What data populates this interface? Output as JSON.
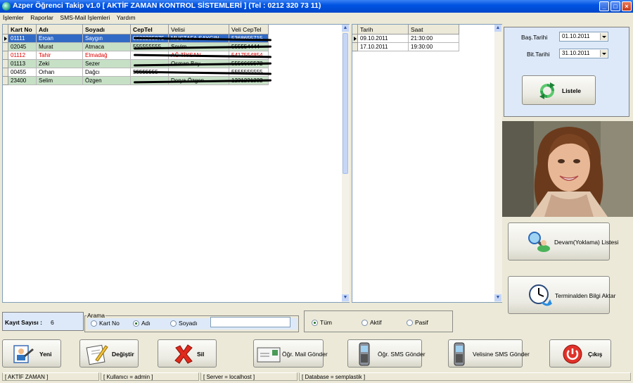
{
  "window": {
    "title": "Azper Öğrenci Takip v1.0 [ AKTİF ZAMAN KONTROL  SİSTEMLERİ  ] (Tel : 0212 320 73 11)",
    "controls": [
      "_",
      "□",
      "×"
    ]
  },
  "menu": [
    "İşlemler",
    "Raporlar",
    "SMS-Mail İşlemleri",
    "Yardım"
  ],
  "students": {
    "columns": [
      "Kart No",
      "Adı",
      "Soyadı",
      "CepTel",
      "Velisi",
      "Veli CepTel"
    ],
    "rows": [
      {
        "kart": "01111",
        "adi": "Ercan",
        "soyadi": "Saygın",
        "cep": "0538205875",
        "veli": "MUSTAFA SAYGIN",
        "velicep": "5368655715",
        "state": "selected"
      },
      {
        "kart": "02045",
        "adi": "Murat",
        "soyadi": "Atmaca",
        "cep": "555555555",
        "veli": "Sevim",
        "velicep": "555554444",
        "state": "normal"
      },
      {
        "kart": "01112",
        "adi": "Tahir",
        "soyadi": "Elmadağ",
        "cep": "",
        "veli": "AĞ TİYSAN",
        "velicep": "5417554854",
        "state": "red"
      },
      {
        "kart": "01113",
        "adi": "Zeki",
        "soyadi": "Sezer",
        "cep": "",
        "veli": "Osman Bey",
        "velicep": "5556665572",
        "state": "normal"
      },
      {
        "kart": "00455",
        "adi": "Orhan",
        "soyadi": "Dağcı",
        "cep": "55555555",
        "veli": "",
        "velicep": "5555555555",
        "state": "normal"
      },
      {
        "kart": "23400",
        "adi": "Selim",
        "soyadi": "Özgen",
        "cep": "",
        "veli": "Derya Özgen",
        "velicep": "1231231232",
        "state": "normal"
      }
    ]
  },
  "attendance": {
    "columns": [
      "Tarih",
      "Saat"
    ],
    "rows": [
      {
        "tarih": "09.10.2011",
        "saat": "21:30:00"
      },
      {
        "tarih": "17.10.2011",
        "saat": "19:30:00"
      }
    ]
  },
  "filter": {
    "start_label": "Baş.Tarihi",
    "start_value": "01.10.2011",
    "end_label": "Bit.Tarihi",
    "end_value": "31.10.2011",
    "list_button": "Listele"
  },
  "side_buttons": {
    "devam": "Devam(Yoklama) Listesi",
    "terminal": "Terminalden Bilgi Aktar"
  },
  "record_count": {
    "label": "Kayıt Sayısı :",
    "value": "6"
  },
  "search": {
    "legend": "Arama",
    "options": [
      "Kart No",
      "Adı",
      "Soyadı"
    ],
    "selected": "Adı",
    "text": ""
  },
  "status_filter": {
    "options": [
      "Tüm",
      "Aktif",
      "Pasif"
    ],
    "selected": "Tüm"
  },
  "actions": {
    "yeni": "Yeni",
    "degistir": "Değiştir",
    "sil": "Sil",
    "mail": "Öğr. Mail Gönder",
    "sms": "Öğr. SMS Gönder",
    "veli_sms": "Velisine SMS Gönder",
    "cikis": "Çıkış"
  },
  "statusbar": [
    "[ AKTİF ZAMAN ]",
    "[ Kullanıcı = admin ]",
    "[ Server = localhost ]",
    "[ Database = semplastik ]"
  ],
  "colors": {
    "selected_row": "#316ac5",
    "alt_row": "#c6e0c6",
    "red_text": "#e00000",
    "panel": "#dde9f8",
    "titlebar": "#0054e3"
  }
}
